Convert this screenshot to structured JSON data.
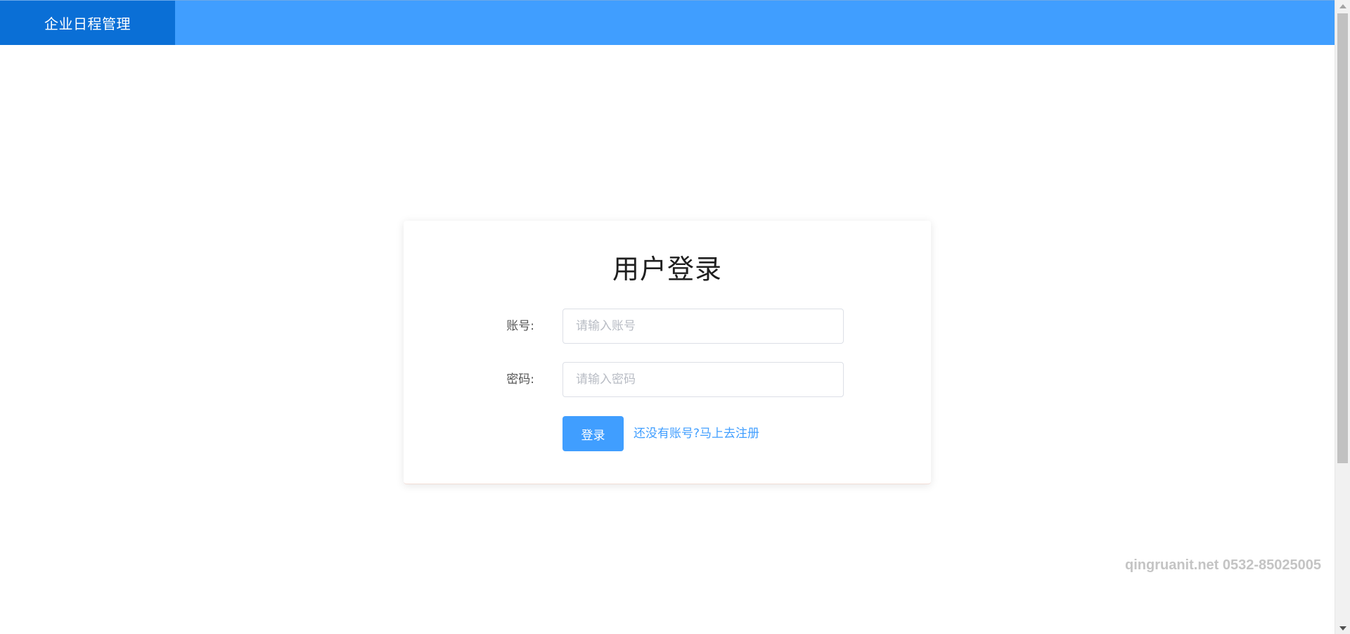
{
  "header": {
    "brand": "企业日程管理"
  },
  "login": {
    "title": "用户登录",
    "account_label": "账号:",
    "account_placeholder": "请输入账号",
    "account_value": "",
    "password_label": "密码:",
    "password_placeholder": "请输入密码",
    "password_value": "",
    "login_button": "登录",
    "register_link": "还没有账号?马上去注册"
  },
  "watermark": "qingruanit.net 0532-85025005",
  "colors": {
    "header_bg": "#409eff",
    "brand_bg": "#0a6fd6",
    "primary": "#409eff",
    "watermark": "#c4c4c4"
  },
  "icons": {
    "scroll_up": "triangle-up",
    "scroll_down": "triangle-down"
  }
}
